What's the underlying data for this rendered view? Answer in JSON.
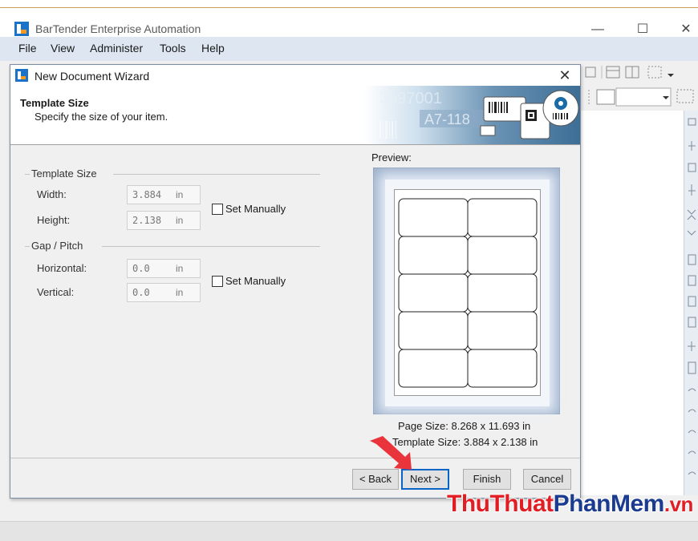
{
  "app": {
    "title": "BarTender Enterprise Automation",
    "window_controls": {
      "minimize": "—",
      "maximize": "☐",
      "close": "✕"
    },
    "menu": [
      "File",
      "View",
      "Administer",
      "Tools",
      "Help"
    ]
  },
  "dialog": {
    "title": "New Document Wizard",
    "close": "✕",
    "header_title": "Template Size",
    "header_subtitle": "Specify the size of your item.",
    "template_size": {
      "group_title": "Template Size",
      "width_label": "Width:",
      "width_value": "3.884",
      "height_label": "Height:",
      "height_value": "2.138",
      "unit": "in",
      "set_manually": "Set Manually"
    },
    "gap_pitch": {
      "group_title": "Gap / Pitch",
      "horizontal_label": "Horizontal:",
      "horizontal_value": "0.0",
      "vertical_label": "Vertical:",
      "vertical_value": "0.0",
      "unit": "in",
      "set_manually": "Set Manually"
    },
    "preview": {
      "label": "Preview:",
      "columns": 2,
      "rows": 5
    },
    "page_size_line": "Page Size:  8.268 x 11.693 in",
    "template_size_line": "Template Size:  3.884 x 2.138 in",
    "buttons": {
      "back": "< Back",
      "next": "Next >",
      "finish": "Finish",
      "cancel": "Cancel"
    }
  },
  "banner_text": {
    "number": "3597001",
    "code": "A7-118"
  },
  "watermark": {
    "part1": "Thu",
    "part2": "Thuat",
    "part3": "Phan",
    "part4": "Mem",
    "part5": ".vn"
  },
  "colors": {
    "accent": "#0a64c8",
    "logo_blue": "#1a73c8",
    "logo_orange": "#f39a1e",
    "arrow": "#e8343a"
  }
}
